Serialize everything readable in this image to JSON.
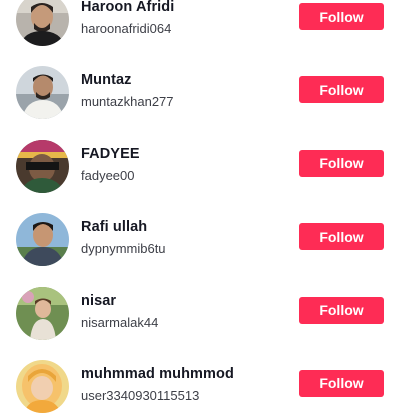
{
  "colors": {
    "follow_button": "#fe2c55",
    "follow_text": "#ffffff",
    "name_text": "#161823",
    "handle_text": "#3d3f47"
  },
  "users": [
    {
      "display_name": "Haroon Afridi",
      "username": "haroonafridi064",
      "action_label": "Follow",
      "avatar_icon": "avatar-photo"
    },
    {
      "display_name": "Muntaz",
      "username": "muntazkhan277",
      "action_label": "Follow",
      "avatar_icon": "avatar-photo"
    },
    {
      "display_name": "FADYEE",
      "username": "fadyee00",
      "action_label": "Follow",
      "avatar_icon": "avatar-photo"
    },
    {
      "display_name": "Rafi ullah",
      "username": "dypnymmib6tu",
      "action_label": "Follow",
      "avatar_icon": "avatar-photo"
    },
    {
      "display_name": "nisar",
      "username": "nisarmalak44",
      "action_label": "Follow",
      "avatar_icon": "avatar-photo"
    },
    {
      "display_name": "muhmmad muhmmod",
      "username": "user3340930115513",
      "action_label": "Follow",
      "avatar_icon": "avatar-photo"
    }
  ]
}
